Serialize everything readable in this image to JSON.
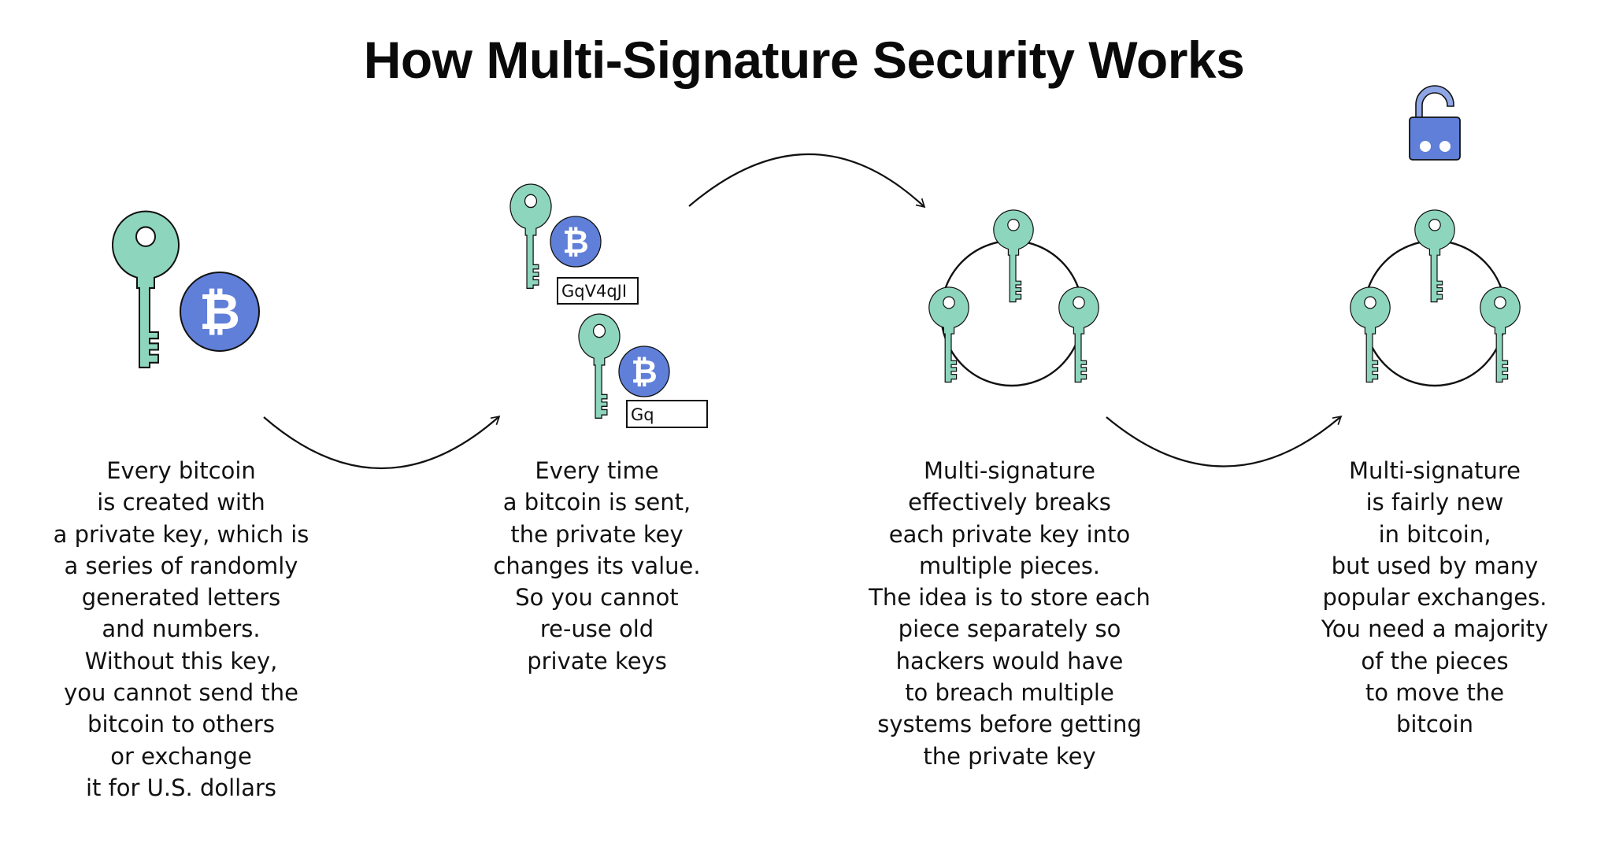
{
  "title": "How Multi-Signature Security Works",
  "colors": {
    "key_fill": "#8dd5bc",
    "coin_fill": "#5f7fd9",
    "lock_body": "#5f7fd9",
    "lock_shackle": "#8fa6e6",
    "outline": "#111111",
    "background": "#ffffff"
  },
  "icons": {
    "key": "key-icon",
    "coin": "bitcoin-coin-icon",
    "coin_glyph": "₿",
    "lock": "unlocked-padlock-icon",
    "arrow": "curved-arrow-icon",
    "ring": "key-ring-icon"
  },
  "steps": [
    {
      "id": "step-1",
      "graphic": "single key with bitcoin coin",
      "lines": [
        "Every bitcoin",
        "is created with",
        "a private key, which is",
        "a series of randomly",
        "generated letters",
        "and numbers.",
        "Without this key,",
        "you cannot send the",
        "bitcoin to others",
        "or exchange",
        "it for U.S. dollars"
      ]
    },
    {
      "id": "step-2",
      "graphic": "two keys with bitcoin coins and key value boxes",
      "key_values": [
        "GqV4qJI",
        "Gq"
      ],
      "lines": [
        "Every time",
        "a bitcoin is sent,",
        "the private key",
        "changes its value.",
        "So you cannot",
        "re-use old",
        "private keys"
      ]
    },
    {
      "id": "step-3",
      "graphic": "three keys on a ring",
      "lines": [
        "Multi-signature",
        "effectively breaks",
        "each private key into",
        "multiple pieces.",
        "The idea is to store each",
        "piece separately so",
        "hackers would have",
        "to breach multiple",
        "systems before getting",
        "the private key"
      ]
    },
    {
      "id": "step-4",
      "graphic": "three keys on a ring with unlocked padlock",
      "lines": [
        "Multi-signature",
        "is fairly new",
        "in bitcoin,",
        "but used by many",
        "popular exchanges.",
        "You need a majority",
        "of the pieces",
        "to move the",
        "bitcoin"
      ]
    }
  ]
}
